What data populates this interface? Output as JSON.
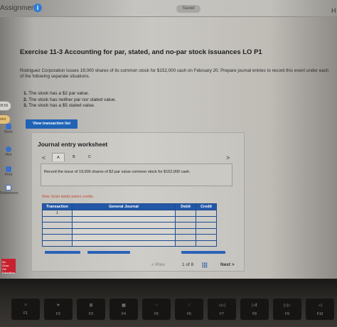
{
  "header": {
    "title": "Assignment",
    "saved": "Saved",
    "help": "H"
  },
  "sidebar": {
    "timer": "09:56",
    "status": "ded",
    "items": [
      {
        "label": "Book",
        "icon": "book-icon"
      },
      {
        "label": "Hint",
        "icon": "hint-icon"
      },
      {
        "label": "Print",
        "icon": "print-icon"
      },
      {
        "label": "References",
        "icon": "references-icon"
      }
    ],
    "logo": [
      "Mc",
      "Graw",
      "Hill",
      "Education"
    ]
  },
  "exercise": {
    "title": "Exercise 11-3 Accounting for par, stated, and no-par stock issuances LO P1",
    "intro": "Rodriguez Corporation issues 19,000 shares of its common stock for $152,000 cash on February 20. Prepare journal entries to record this event under each of the following separate situations.",
    "parts": [
      {
        "num": "1.",
        "text": "The stock has a $2 par value."
      },
      {
        "num": "2.",
        "text": "The stock has neither par nor stated value."
      },
      {
        "num": "3.",
        "text": "The stock has a $5 stated value."
      }
    ],
    "view_button": "View transaction list"
  },
  "worksheet": {
    "title": "Journal entry worksheet",
    "nav_prev": "<",
    "nav_next": ">",
    "tabs": [
      "A",
      "B",
      "C"
    ],
    "active_tab": "A",
    "description": "Record the issue of 19,000 shares of $2 par value common stock for $152,000 cash.",
    "note": "Note: Enter debits before credits.",
    "columns": [
      "Transaction",
      "General Journal",
      "Debit",
      "Credit"
    ],
    "rows": [
      {
        "transaction": "1"
      },
      {
        "transaction": ""
      },
      {
        "transaction": ""
      },
      {
        "transaction": ""
      },
      {
        "transaction": ""
      },
      {
        "transaction": ""
      }
    ]
  },
  "pager": {
    "prev": "Prev",
    "count": "1 of 8",
    "next": "Next"
  },
  "keyboard": {
    "keys": [
      {
        "sym": "☼",
        "label": "F1"
      },
      {
        "sym": "☀",
        "label": "F2"
      },
      {
        "sym": "⊞",
        "label": "F3"
      },
      {
        "sym": "▦",
        "label": "F4"
      },
      {
        "sym": "⁘",
        "label": "F5"
      },
      {
        "sym": "⁙",
        "label": "F6"
      },
      {
        "sym": "◁◁",
        "label": "F7"
      },
      {
        "sym": "▷‖",
        "label": "F8"
      },
      {
        "sym": "▷▷",
        "label": "F9"
      },
      {
        "sym": "◁",
        "label": "F10"
      }
    ]
  }
}
